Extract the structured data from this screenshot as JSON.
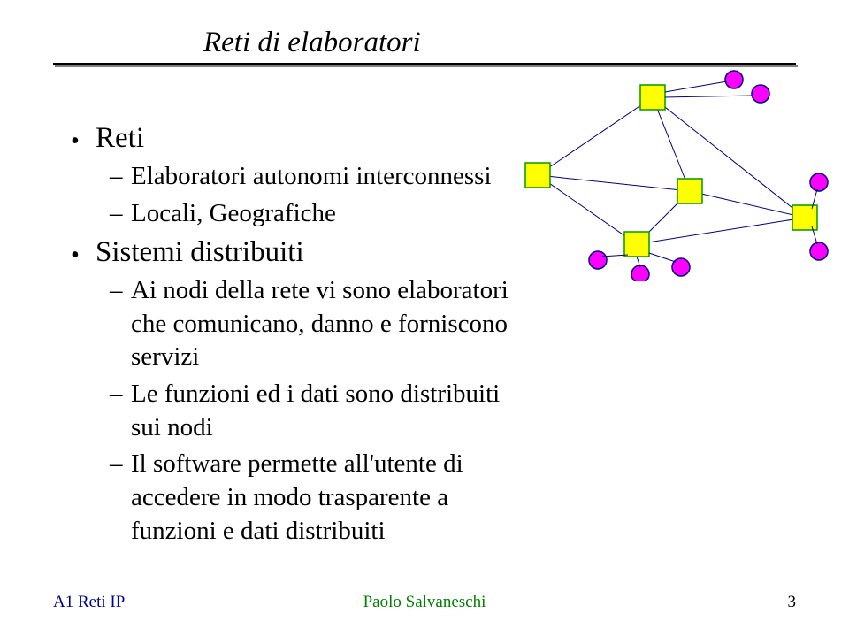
{
  "title": "Reti di elaboratori",
  "bullets": {
    "b1": "Reti",
    "b1_1": "Elaboratori autonomi interconnessi",
    "b1_2": "Locali, Geografiche",
    "b2": "Sistemi distribuiti",
    "b2_1": "Ai nodi della rete vi sono elaboratori che comunicano, danno e forniscono servizi",
    "b2_2": "Le funzioni ed i dati sono distribuiti sui nodi",
    "b2_3": "Il software permette all'utente di accedere in modo trasparente a funzioni e dati distribuiti"
  },
  "footer": {
    "left": "A1 Reti IP",
    "center": "Paolo Salvaneschi",
    "right": "3"
  },
  "diagram": {
    "squareFill": "#FFFF00",
    "squareStroke": "#009900",
    "circleFill": "#FF00FF",
    "circleStroke": "#000080",
    "lineStroke": "#000080"
  }
}
